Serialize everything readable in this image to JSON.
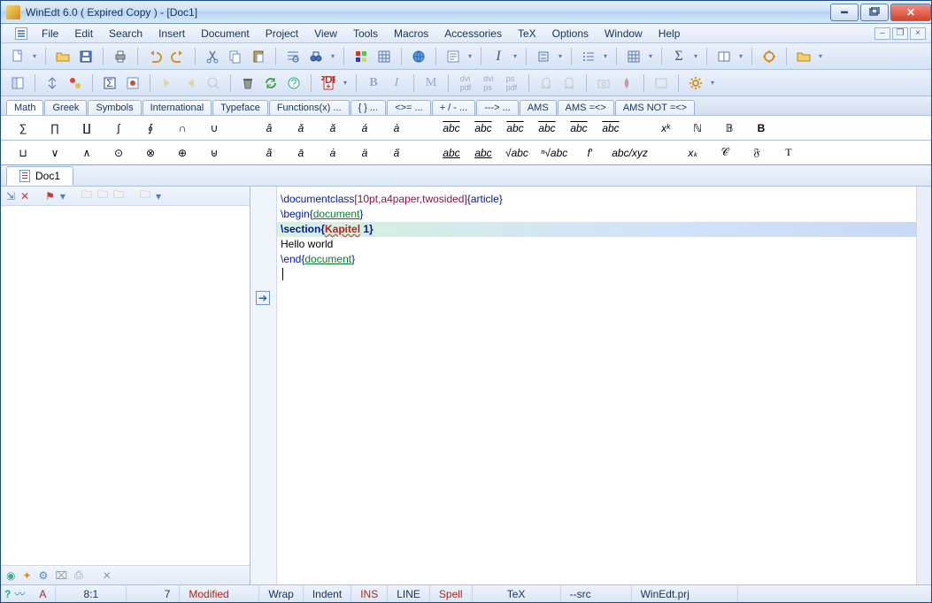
{
  "window": {
    "title": "WinEdt 6.0  ( Expired  Copy )   - [Doc1]"
  },
  "menu": [
    "File",
    "Edit",
    "Search",
    "Insert",
    "Document",
    "Project",
    "View",
    "Tools",
    "Macros",
    "Accessories",
    "TeX",
    "Options",
    "Window",
    "Help"
  ],
  "symtabs": [
    "Math",
    "Greek",
    "Symbols",
    "International",
    "Typeface",
    "Functions(x)  ...",
    "{ }  ...",
    "<>=  ...",
    "+ / -  ...",
    "--->  ...",
    "AMS",
    "AMS  =<>",
    "AMS NOT =<>"
  ],
  "symrow1": [
    "∑",
    "∏",
    "∐",
    "∫",
    "∮",
    "∩",
    "∪",
    "â",
    "ǎ",
    "ă",
    "á",
    "à",
    "abc",
    "abc",
    "abc",
    "abc",
    "abc",
    "abc",
    "xᵏ",
    "ℕ",
    "𝔹",
    "B"
  ],
  "symrow2": [
    "⊔",
    "∨",
    "∧",
    "⊙",
    "⊗",
    "⊕",
    "⊎",
    "ã",
    "ā",
    "ȧ",
    "ä",
    "a̋",
    "abc",
    "abc",
    "√abc",
    "ⁿ√abc",
    "f′",
    "abc/xyz",
    "xₖ",
    "𝒞",
    "𝔉",
    "T"
  ],
  "doc_tab": "Doc1",
  "code": {
    "l1a": "\\documentclass",
    "l1b": "[10pt,a4paper,twosided]",
    "l1c": "{article}",
    "l2": "",
    "l3a": "\\begin{",
    "l3b": "document",
    "l3c": "}",
    "l4a": "\\section{",
    "l4b": "Kapitel",
    "l4c": " 1}",
    "l5": "Hello world",
    "l6": "",
    "l7a": "\\end{",
    "l7b": "document",
    "l7c": "}"
  },
  "status": {
    "a": "A",
    "pos": "8:1",
    "col": "7",
    "mod": "Modified",
    "wrap": "Wrap",
    "indent": "Indent",
    "ins": "INS",
    "line": "LINE",
    "spell": "Spell",
    "tex": "TeX",
    "src": "--src",
    "prj": "WinEdt.prj"
  }
}
